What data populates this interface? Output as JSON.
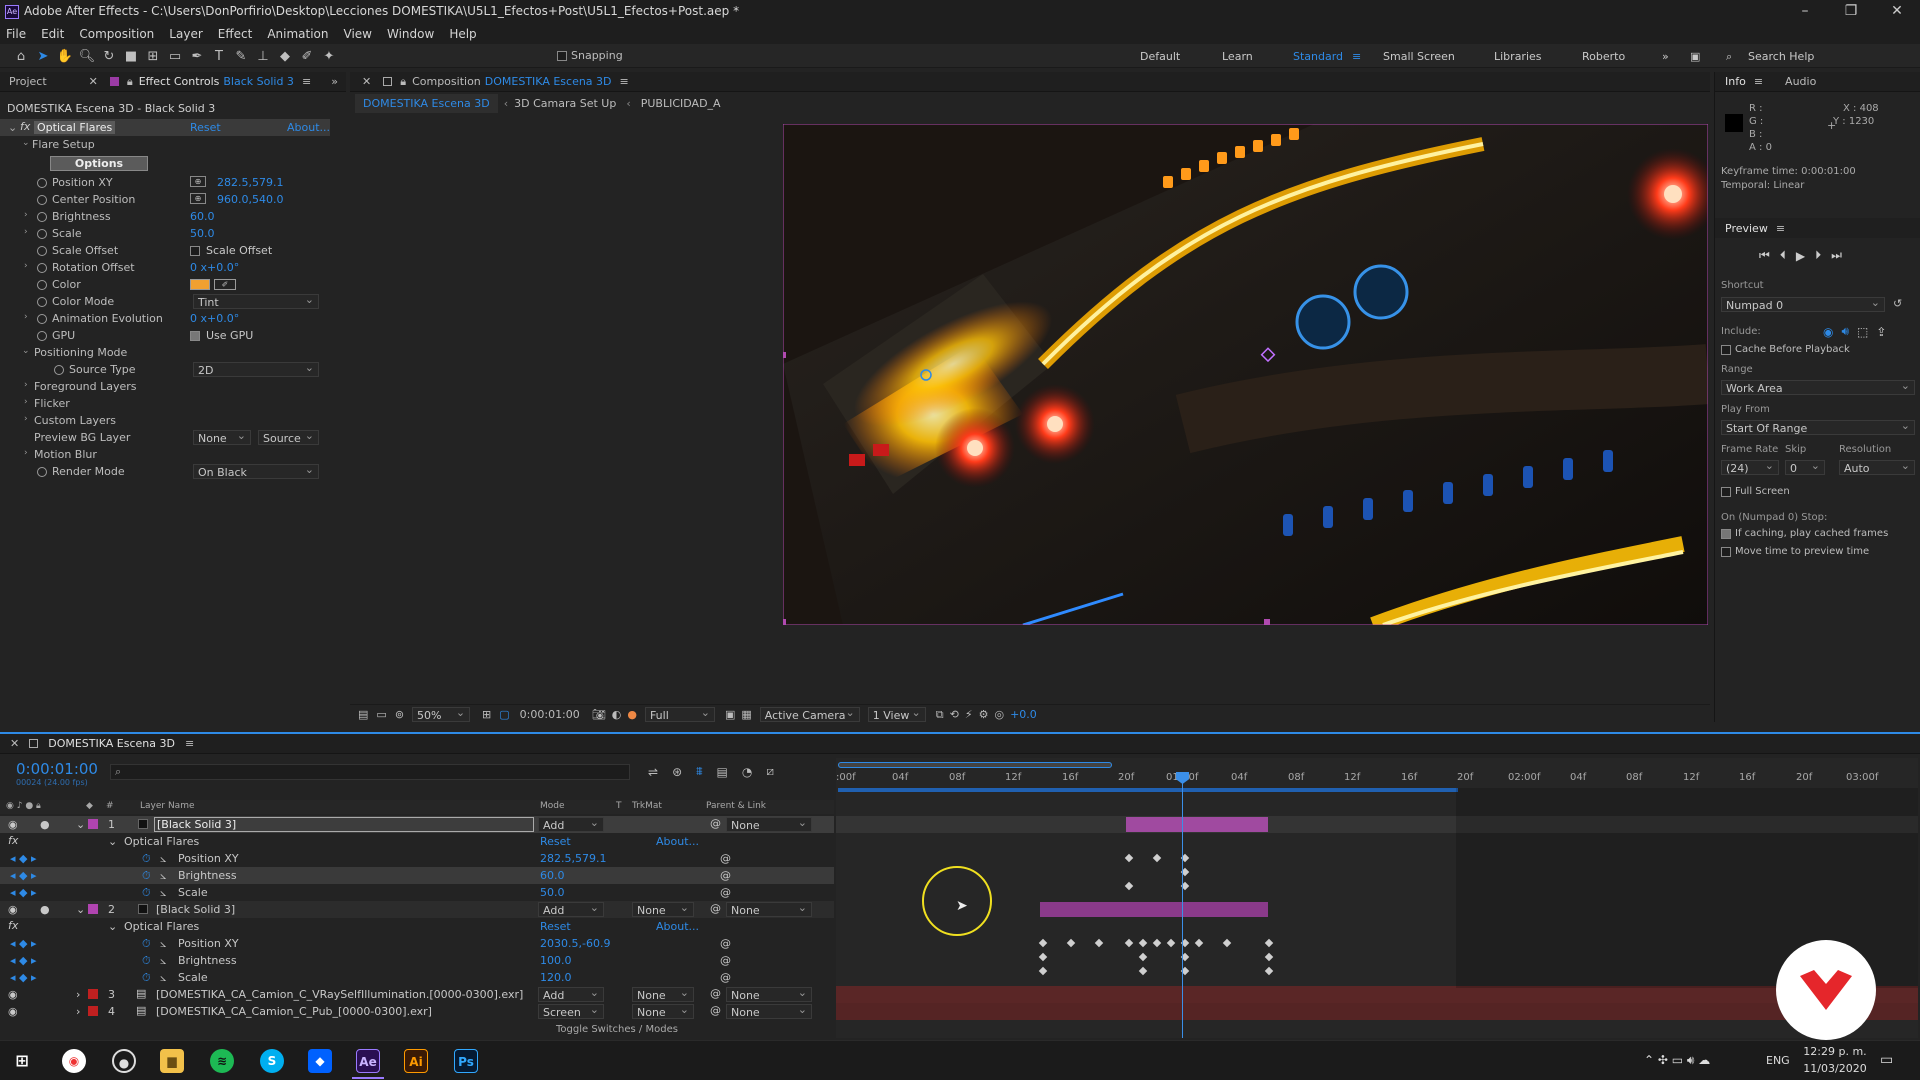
{
  "title": "Adobe After Effects - C:\\Users\\DonPorfirio\\Desktop\\Lecciones DOMESTIKA\\U5L1_Efectos+Post\\U5L1_Efectos+Post.aep *",
  "menu": [
    "File",
    "Edit",
    "Composition",
    "Layer",
    "Effect",
    "Animation",
    "View",
    "Window",
    "Help"
  ],
  "toolbar": {
    "snapping": "Snapping"
  },
  "workspaces": [
    "Default",
    "Learn",
    "Standard",
    "Small Screen",
    "Libraries",
    "Roberto"
  ],
  "search_help": "Search Help",
  "left_panel": {
    "tab_project": "Project",
    "tab_effect_controls": "Effect Controls",
    "tab_effect_target": "Black Solid 3",
    "header": "DOMESTIKA Escena 3D - Black Solid 3",
    "effect_name": "Optical Flares",
    "reset": "Reset",
    "about": "About...",
    "flare_setup": "Flare Setup",
    "options_btn": "Options",
    "props": [
      {
        "name": "Position XY",
        "value": "282.5,579.1"
      },
      {
        "name": "Center Position",
        "value": "960.0,540.0"
      },
      {
        "name": "Brightness",
        "value": "60.0"
      },
      {
        "name": "Scale",
        "value": "50.0"
      },
      {
        "name": "Scale Offset",
        "value": "Scale Offset"
      },
      {
        "name": "Rotation Offset",
        "value": "0 x+0.0°"
      },
      {
        "name": "Color",
        "value": ""
      },
      {
        "name": "Color Mode",
        "value": "Tint"
      },
      {
        "name": "Animation Evolution",
        "value": "0 x+0.0°"
      },
      {
        "name": "GPU",
        "value": "Use GPU"
      },
      {
        "name": "Positioning Mode",
        "value": ""
      },
      {
        "name": "Source Type",
        "value": "2D"
      },
      {
        "name": "Foreground Layers",
        "value": ""
      },
      {
        "name": "Flicker",
        "value": ""
      },
      {
        "name": "Custom Layers",
        "value": ""
      },
      {
        "name": "Preview BG Layer",
        "value": "None"
      },
      {
        "name": "Motion Blur",
        "value": ""
      },
      {
        "name": "Render Mode",
        "value": "On Black"
      }
    ],
    "preview_bg_source": "Source"
  },
  "viewer": {
    "tab_label": "Composition",
    "comp_name": "DOMESTIKA Escena 3D",
    "crumbs": [
      "DOMESTIKA Escena 3D",
      "3D Camara Set Up",
      "PUBLICIDAD_A"
    ],
    "zoom": "50%",
    "time": "0:00:01:00",
    "quality": "Full",
    "camera": "Active Camera",
    "views": "1 View",
    "exposure": "+0.0"
  },
  "right_panel": {
    "tab_info": "Info",
    "tab_audio": "Audio",
    "info_rgb": [
      "R :",
      "G :",
      "B :",
      "A : 0"
    ],
    "x": "X : 408",
    "y": "Y : 1230",
    "kf_time": "Keyframe time: 0:00:01:00",
    "temporal": "Temporal: Linear",
    "preview": "Preview",
    "shortcut_label": "Shortcut",
    "shortcut": "Numpad 0",
    "include": "Include:",
    "cache": "Cache Before Playback",
    "range_label": "Range",
    "range": "Work Area",
    "play_from_label": "Play From",
    "play_from": "Start Of Range",
    "fr_label": "Frame Rate",
    "skip_label": "Skip",
    "res_label": "Resolution",
    "fr": "(24)",
    "skip": "0",
    "res": "Auto",
    "full_screen": "Full Screen",
    "stop_label": "On (Numpad 0) Stop:",
    "if_caching": "If caching, play cached frames",
    "move_time": "Move time to preview time"
  },
  "timeline": {
    "tab": "DOMESTIKA Escena 3D",
    "time": "0:00:01:00",
    "time_sub": "00024 (24.00 fps)",
    "cols": {
      "layer_name": "Layer Name",
      "mode": "Mode",
      "t": "T",
      "trkmat": "TrkMat",
      "parent": "Parent & Link"
    },
    "ruler": [
      ":00f",
      "04f",
      "08f",
      "12f",
      "16f",
      "20f",
      "01:00f",
      "04f",
      "08f",
      "12f",
      "16f",
      "20f",
      "02:00f",
      "04f",
      "08f",
      "12f",
      "16f",
      "20f",
      "03:00f"
    ],
    "rows": [
      {
        "num": "1",
        "name": "[Black Solid 3]",
        "mode": "Add",
        "trk": "",
        "parent": "None"
      },
      {
        "name": "Optical Flares",
        "reset": "Reset",
        "about": "About..."
      },
      {
        "name": "Position XY",
        "value": "282.5,579.1"
      },
      {
        "name": "Brightness",
        "value": "60.0"
      },
      {
        "name": "Scale",
        "value": "50.0"
      },
      {
        "num": "2",
        "name": "[Black Solid 3]",
        "mode": "Add",
        "trk": "None",
        "parent": "None"
      },
      {
        "name": "Optical Flares",
        "reset": "Reset",
        "about": "About..."
      },
      {
        "name": "Position XY",
        "value": "2030.5,-60.9"
      },
      {
        "name": "Brightness",
        "value": "100.0"
      },
      {
        "name": "Scale",
        "value": "120.0"
      },
      {
        "num": "3",
        "name": "[DOMESTIKA_CA_Camion_C_VRaySelfIllumination.[0000-0300].exr]",
        "mode": "Add",
        "trk": "None",
        "parent": "None"
      },
      {
        "num": "4",
        "name": "[DOMESTIKA_CA_Camion_C_Pub_[0000-0300].exr]",
        "mode": "Screen",
        "trk": "None",
        "parent": "None"
      }
    ],
    "toggle": "Toggle Switches / Modes"
  },
  "taskbar": {
    "lang": "ENG",
    "time": "12:29 p. m.",
    "date": "11/03/2020"
  },
  "colors": {
    "accent": "#2e8ae6",
    "layer_purple": "#8a3a8a",
    "layer_red": "#5a2626"
  }
}
